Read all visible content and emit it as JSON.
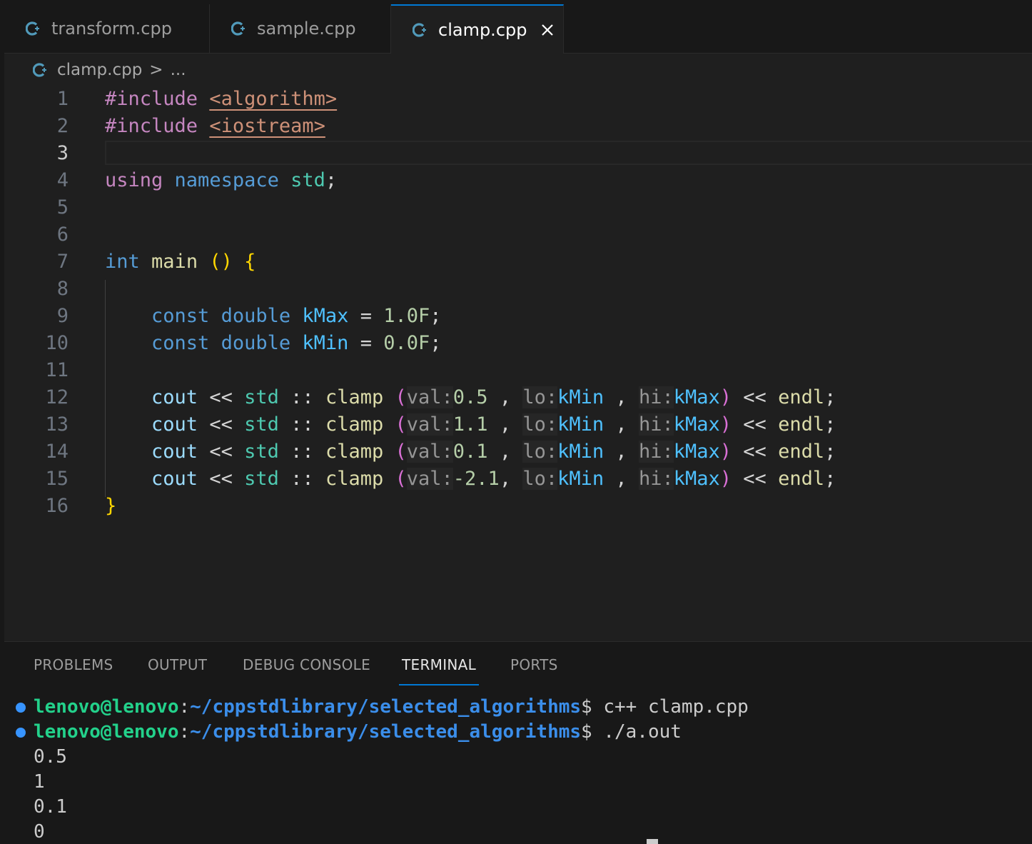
{
  "tabs": [
    {
      "label": "transform.cpp",
      "active": false
    },
    {
      "label": "sample.cpp",
      "active": false
    },
    {
      "label": "clamp.cpp",
      "active": true
    }
  ],
  "breadcrumb": {
    "file": "clamp.cpp",
    "separator": ">",
    "rest": "..."
  },
  "editor": {
    "current_line": "3",
    "line_numbers": [
      "1",
      "2",
      "3",
      "4",
      "5",
      "6",
      "7",
      "8",
      "9",
      "10",
      "11",
      "12",
      "13",
      "14",
      "15",
      "16"
    ],
    "lines": {
      "l1": {
        "kw": "#include",
        "hdr": "<algorithm>"
      },
      "l2": {
        "kw": "#include",
        "hdr": "<iostream>"
      },
      "l4": {
        "using": "using",
        "namespace": "namespace",
        "std": "std",
        "semi": ";"
      },
      "l7": {
        "int": "int",
        "main": "main",
        "parens": "()",
        "brace": "{"
      },
      "l9": {
        "const": "const",
        "double": "double",
        "name": "kMax",
        "eq": "=",
        "value": "1.0F",
        "semi": ";"
      },
      "l10": {
        "const": "const",
        "double": "double",
        "name": "kMin",
        "eq": "=",
        "value": "0.0F",
        "semi": ";"
      },
      "calls": [
        {
          "cout": "cout",
          "op": "<<",
          "std": "std",
          "scope": "::",
          "fn": "clamp",
          "open": "(",
          "h1": "val:",
          "a1": "0.5 ",
          "c1": ",",
          "h2": "lo:",
          "a2": "kMin ",
          "c2": ",",
          "h3": "hi:",
          "a3": "kMax",
          "close": ")",
          "op2": "<<",
          "endl": "endl",
          "semi": ";"
        },
        {
          "cout": "cout",
          "op": "<<",
          "std": "std",
          "scope": "::",
          "fn": "clamp",
          "open": "(",
          "h1": "val:",
          "a1": "1.1 ",
          "c1": ",",
          "h2": "lo:",
          "a2": "kMin ",
          "c2": ",",
          "h3": "hi:",
          "a3": "kMax",
          "close": ")",
          "op2": "<<",
          "endl": "endl",
          "semi": ";"
        },
        {
          "cout": "cout",
          "op": "<<",
          "std": "std",
          "scope": "::",
          "fn": "clamp",
          "open": "(",
          "h1": "val:",
          "a1": "0.1 ",
          "c1": ",",
          "h2": "lo:",
          "a2": "kMin ",
          "c2": ",",
          "h3": "hi:",
          "a3": "kMax",
          "close": ")",
          "op2": "<<",
          "endl": "endl",
          "semi": ";"
        },
        {
          "cout": "cout",
          "op": "<<",
          "std": "std",
          "scope": "::",
          "fn": "clamp",
          "open": "(",
          "h1": "val:",
          "a1": "-2.1",
          "c1": ",",
          "h2": "lo:",
          "a2": "kMin ",
          "c2": ",",
          "h3": "hi:",
          "a3": "kMax",
          "close": ")",
          "op2": "<<",
          "endl": "endl",
          "semi": ";"
        }
      ],
      "l16": {
        "brace": "}"
      }
    }
  },
  "panel": {
    "tabs": [
      "PROBLEMS",
      "OUTPUT",
      "DEBUG CONSOLE",
      "TERMINAL",
      "PORTS"
    ],
    "active_tab": "TERMINAL"
  },
  "terminal": {
    "commands": [
      {
        "user": "lenovo@lenovo",
        "colon": ":",
        "path": "~/cppstdlibrary/selected_algorithms",
        "prompt": "$ ",
        "cmd": "c++ clamp.cpp"
      },
      {
        "user": "lenovo@lenovo",
        "colon": ":",
        "path": "~/cppstdlibrary/selected_algorithms",
        "prompt": "$ ",
        "cmd": "./a.out"
      }
    ],
    "output": [
      "0.5",
      "1",
      "0.1",
      "0"
    ]
  },
  "colors": {
    "accent": "#0078d4",
    "cpp_icon": "#519aba",
    "terminal_user": "#23d18b",
    "terminal_path": "#3b8eea",
    "status_dot": "#3794ff"
  },
  "icons": {
    "tab_icon": "cpp-file-icon",
    "close": "close-icon",
    "status": "command-decoration-icon"
  }
}
